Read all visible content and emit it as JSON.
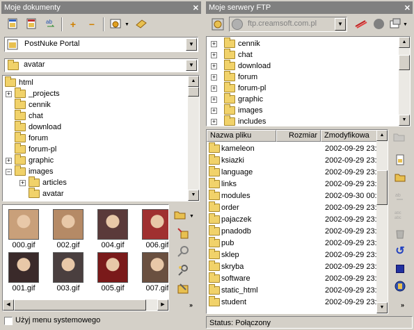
{
  "left": {
    "title": "Moje dokumenty",
    "close": "✕",
    "site_combo": "PostNuke Portal",
    "path_combo": "avatar",
    "tree": [
      {
        "label": "html",
        "indent": 0,
        "toggle": ""
      },
      {
        "label": "_projects",
        "indent": 1,
        "toggle": "+"
      },
      {
        "label": "cennik",
        "indent": 1,
        "toggle": ""
      },
      {
        "label": "chat",
        "indent": 1,
        "toggle": ""
      },
      {
        "label": "download",
        "indent": 1,
        "toggle": ""
      },
      {
        "label": "forum",
        "indent": 1,
        "toggle": ""
      },
      {
        "label": "forum-pl",
        "indent": 1,
        "toggle": ""
      },
      {
        "label": "graphic",
        "indent": 1,
        "toggle": "+"
      },
      {
        "label": "images",
        "indent": 1,
        "toggle": "−"
      },
      {
        "label": "articles",
        "indent": 2,
        "toggle": "+"
      },
      {
        "label": "avatar",
        "indent": 2,
        "toggle": ""
      }
    ],
    "thumbnails": [
      {
        "label": "000.gif",
        "color": "#c9a07a"
      },
      {
        "label": "002.gif",
        "color": "#b58a66"
      },
      {
        "label": "004.gif",
        "color": "#5a3a3a"
      },
      {
        "label": "006.gif",
        "color": "#a03030"
      },
      {
        "label": "001.gif",
        "color": "#3a2a2a"
      },
      {
        "label": "003.gif",
        "color": "#4a3f3f"
      },
      {
        "label": "005.gif",
        "color": "#7a1a1a"
      },
      {
        "label": "007.gif",
        "color": "#6a5040"
      }
    ],
    "checkbox_label": "Użyj menu systemowego"
  },
  "right": {
    "title": "Moje serwery FTP",
    "close": "✕",
    "server": "ftp.creamsoft.com.pl",
    "tree": [
      "cennik",
      "chat",
      "download",
      "forum",
      "forum-pl",
      "graphic",
      "images",
      "includes"
    ],
    "columns": [
      "Nazwa pliku",
      "Rozmiar",
      "Zmodyfikowa"
    ],
    "files": [
      {
        "name": "kameleon",
        "date": "2002-09-29 23:"
      },
      {
        "name": "ksiazki",
        "date": "2002-09-29 23:"
      },
      {
        "name": "language",
        "date": "2002-09-29 23:"
      },
      {
        "name": "links",
        "date": "2002-09-29 23:"
      },
      {
        "name": "modules",
        "date": "2002-09-30 00:"
      },
      {
        "name": "order",
        "date": "2002-09-29 23:"
      },
      {
        "name": "pajaczek",
        "date": "2002-09-29 23:"
      },
      {
        "name": "pnadodb",
        "date": "2002-09-29 23:"
      },
      {
        "name": "pub",
        "date": "2002-09-29 23:"
      },
      {
        "name": "sklep",
        "date": "2002-09-29 23:"
      },
      {
        "name": "skryba",
        "date": "2002-09-29 23:"
      },
      {
        "name": "software",
        "date": "2002-09-29 23:"
      },
      {
        "name": "static_html",
        "date": "2002-09-29 23:"
      },
      {
        "name": "student",
        "date": "2002-09-29 23:"
      }
    ],
    "status": "Status: Połączony"
  }
}
